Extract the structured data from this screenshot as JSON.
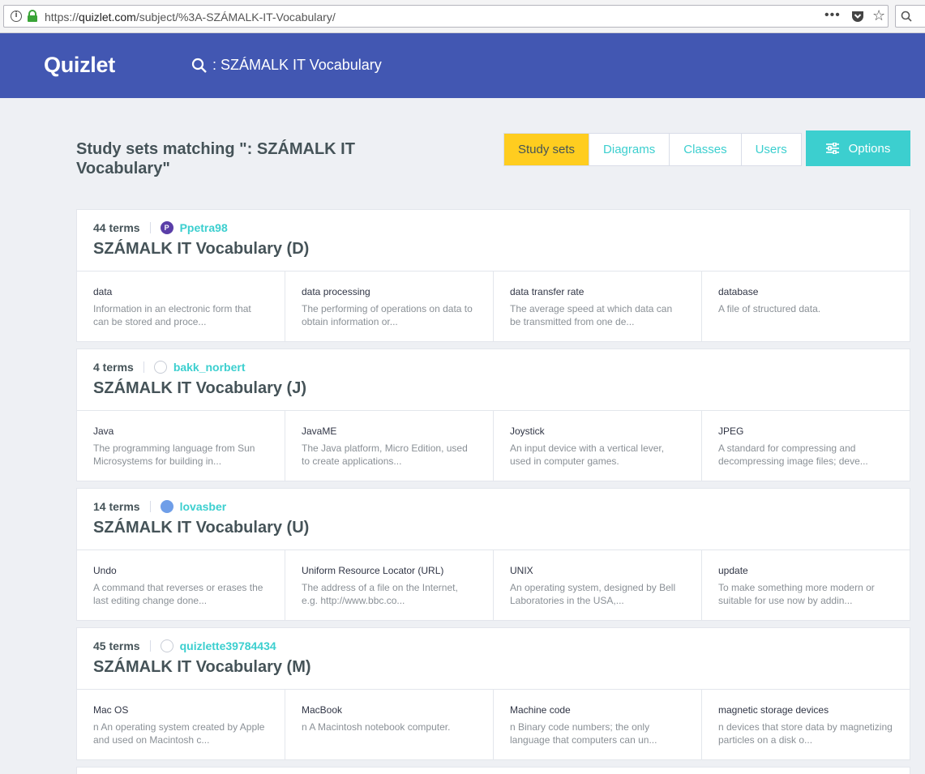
{
  "browser": {
    "url_prefix": "https://",
    "url_domain": "quizlet.com",
    "url_path": "/subject/%3A-SZÁMALK-IT-Vocabulary/"
  },
  "header": {
    "logo": "Quizlet",
    "search_query": ": SZÁMALK IT Vocabulary"
  },
  "page": {
    "title": "Study sets matching \": SZÁMALK IT Vocabulary\"",
    "tabs": [
      "Study sets",
      "Diagrams",
      "Classes",
      "Users"
    ],
    "active_tab": "Study sets",
    "options_label": "Options"
  },
  "sets": [
    {
      "count": "44 terms",
      "user": "Ppetra98",
      "avatar_color": "#5a3ea8",
      "avatar_letter": "P",
      "title": "SZÁMALK IT Vocabulary (D)",
      "terms": [
        {
          "word": "data",
          "def": "Information in an electronic form that can be stored and proce..."
        },
        {
          "word": "data processing",
          "def": "The performing of operations on data to obtain information or..."
        },
        {
          "word": "data transfer rate",
          "def": "The average speed at which data can be transmitted from one de..."
        },
        {
          "word": "database",
          "def": "A file of structured data."
        }
      ]
    },
    {
      "count": "4 terms",
      "user": "bakk_norbert",
      "avatar_color": "#ffffff",
      "avatar_letter": "",
      "title": "SZÁMALK IT Vocabulary (J)",
      "terms": [
        {
          "word": "Java",
          "def": "The programming language from Sun Microsystems for building in..."
        },
        {
          "word": "JavaME",
          "def": "The Java platform, Micro Edition, used to create applications..."
        },
        {
          "word": "Joystick",
          "def": "An input device with a vertical lever, used in computer games."
        },
        {
          "word": "JPEG",
          "def": "A standard for compressing and decompressing image files; deve..."
        }
      ]
    },
    {
      "count": "14 terms",
      "user": "lovasber",
      "avatar_color": "#6f9ee8",
      "avatar_letter": "",
      "title": "SZÁMALK IT Vocabulary (U)",
      "terms": [
        {
          "word": "Undo",
          "def": "A command that reverses or erases the last editing change done..."
        },
        {
          "word": "Uniform Resource Locator (URL)",
          "def": "The address of a file on the Internet, e.g. http://www.bbc.co..."
        },
        {
          "word": "UNIX",
          "def": "An operating system, designed by Bell Laboratories in the USA,..."
        },
        {
          "word": "update",
          "def": "To make something more modern or suitable for use now by addin..."
        }
      ]
    },
    {
      "count": "45 terms",
      "user": "quizlette39784434",
      "avatar_color": "#ffffff",
      "avatar_letter": "",
      "title": "SZÁMALK IT Vocabulary (M)",
      "terms": [
        {
          "word": "Mac OS",
          "def": "n An operating system created by Apple and used on Macintosh c..."
        },
        {
          "word": "MacBook",
          "def": "n A Macintosh notebook computer."
        },
        {
          "word": "Machine code",
          "def": "n Binary code numbers; the only language that computers can un..."
        },
        {
          "word": "magnetic storage devices",
          "def": "n devices that store data by magnetizing particles on a disk o..."
        }
      ]
    }
  ]
}
